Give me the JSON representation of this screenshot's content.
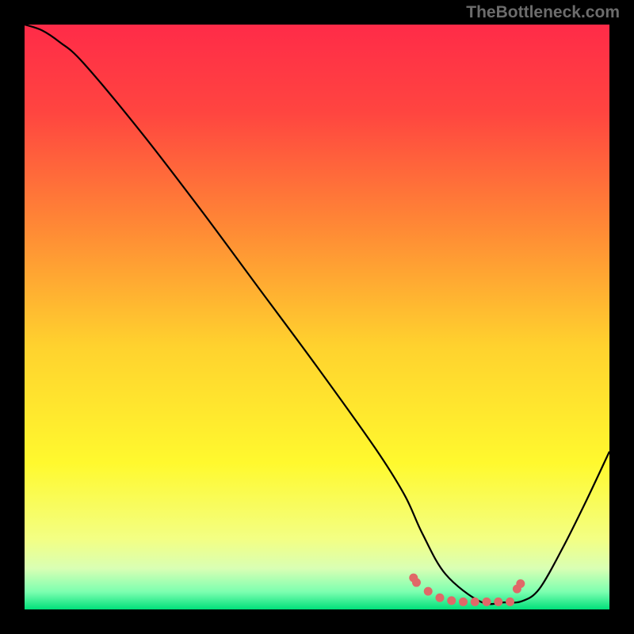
{
  "watermark": "TheBottleneck.com",
  "chart_data": {
    "type": "line",
    "title": "",
    "xlabel": "",
    "ylabel": "",
    "xlim": [
      0,
      100
    ],
    "ylim": [
      0,
      100
    ],
    "grid": false,
    "legend": false,
    "background_gradient": {
      "stops": [
        {
          "offset": 0.0,
          "color": "#ff2b48"
        },
        {
          "offset": 0.15,
          "color": "#ff4540"
        },
        {
          "offset": 0.35,
          "color": "#ff8a35"
        },
        {
          "offset": 0.55,
          "color": "#ffd22e"
        },
        {
          "offset": 0.75,
          "color": "#fff92e"
        },
        {
          "offset": 0.88,
          "color": "#f3ff84"
        },
        {
          "offset": 0.93,
          "color": "#d9ffb4"
        },
        {
          "offset": 0.97,
          "color": "#7cffb0"
        },
        {
          "offset": 1.0,
          "color": "#00e07a"
        }
      ]
    },
    "series": [
      {
        "name": "curve",
        "color": "#000000",
        "x": [
          0.0,
          3.0,
          6.0,
          10.0,
          20.0,
          30.0,
          40.0,
          50.0,
          60.0,
          65.0,
          68.0,
          72.0,
          78.0,
          82.0,
          85.0,
          88.0,
          92.0,
          96.0,
          100.0
        ],
        "values": [
          100.0,
          99.0,
          97.0,
          93.5,
          81.5,
          68.5,
          55.0,
          41.5,
          27.5,
          19.5,
          13.0,
          6.0,
          1.3,
          1.2,
          1.4,
          3.5,
          10.5,
          18.5,
          27.0
        ]
      }
    ],
    "markers": {
      "name": "highlight-dots",
      "color": "#e06868",
      "x": [
        66.5,
        67.0,
        69.0,
        71.0,
        73.0,
        75.0,
        77.0,
        79.0,
        81.0,
        83.0,
        84.2,
        84.8
      ],
      "values": [
        5.4,
        4.6,
        3.1,
        2.0,
        1.5,
        1.3,
        1.3,
        1.3,
        1.3,
        1.3,
        3.5,
        4.4
      ]
    }
  }
}
